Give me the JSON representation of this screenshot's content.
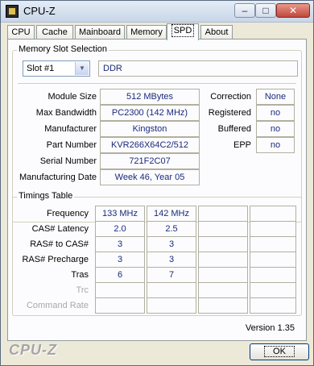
{
  "window": {
    "title": "CPU-Z"
  },
  "titlebar_buttons": {
    "minimize": "‒",
    "maximize": "□",
    "close": "✕"
  },
  "tabs": [
    {
      "label": "CPU"
    },
    {
      "label": "Cache"
    },
    {
      "label": "Mainboard"
    },
    {
      "label": "Memory"
    },
    {
      "label": "SPD"
    },
    {
      "label": "About"
    }
  ],
  "slot_selection": {
    "title": "Memory Slot Selection",
    "slot": "Slot #1",
    "type": "DDR"
  },
  "module": {
    "size_label": "Module Size",
    "size": "512 MBytes",
    "bandwidth_label": "Max Bandwidth",
    "bandwidth": "PC2300 (142 MHz)",
    "manufacturer_label": "Manufacturer",
    "manufacturer": "Kingston",
    "part_label": "Part Number",
    "part": "KVR266X64C2/512",
    "serial_label": "Serial Number",
    "serial": "721F2C07",
    "date_label": "Manufacturing Date",
    "date": "Week 46, Year 05",
    "correction_label": "Correction",
    "correction": "None",
    "registered_label": "Registered",
    "registered": "no",
    "buffered_label": "Buffered",
    "buffered": "no",
    "epp_label": "EPP",
    "epp": "no"
  },
  "timings": {
    "title": "Timings Table",
    "rows": [
      {
        "label": "Frequency",
        "values": [
          "133 MHz",
          "142 MHz",
          "",
          ""
        ]
      },
      {
        "label": "CAS# Latency",
        "values": [
          "2.0",
          "2.5",
          "",
          ""
        ]
      },
      {
        "label": "RAS# to CAS#",
        "values": [
          "3",
          "3",
          "",
          ""
        ]
      },
      {
        "label": "RAS# Precharge",
        "values": [
          "3",
          "3",
          "",
          ""
        ]
      },
      {
        "label": "Tras",
        "values": [
          "6",
          "7",
          "",
          ""
        ]
      },
      {
        "label": "Trc",
        "values": [
          "",
          "",
          "",
          ""
        ]
      },
      {
        "label": "Command Rate",
        "values": [
          "",
          "",
          "",
          ""
        ]
      }
    ]
  },
  "version": "Version 1.35",
  "brand": "CPU-Z",
  "ok_label": "OK"
}
